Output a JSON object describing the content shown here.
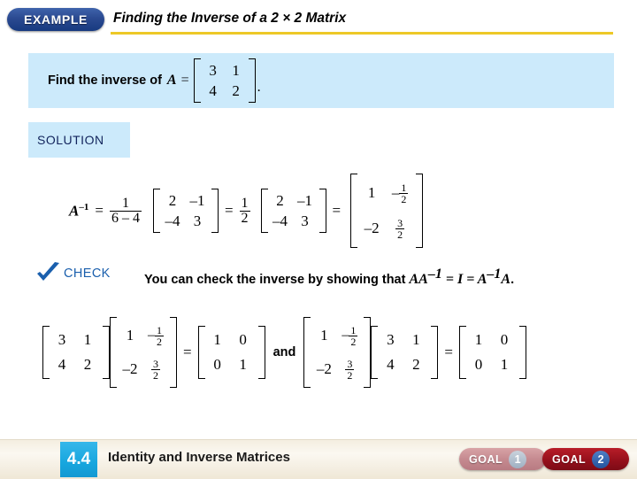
{
  "header": {
    "badge_label": "EXAMPLE",
    "title": "Finding the Inverse of a 2 × 2 Matrix",
    "rule_color": "#edc827",
    "badge_color": "#2b4a91"
  },
  "problem": {
    "text_before": "Find the inverse of",
    "var": "A",
    "equals": "=",
    "matrix": [
      [
        "3",
        "1"
      ],
      [
        "4",
        "2"
      ]
    ],
    "period": ".",
    "box_color": "#cceafb"
  },
  "solution": {
    "label": "SOLUTION",
    "box_color": "#cceafb",
    "label_color": "#12245c",
    "lhs_var": "A",
    "lhs_exp": "–1",
    "eq1": "=",
    "scalar1_num": "1",
    "scalar1_den": "6 – 4",
    "matrix1": [
      [
        "2",
        "–1"
      ],
      [
        "–4",
        "3"
      ]
    ],
    "eq2": "=",
    "scalar2_num": "1",
    "scalar2_den": "2",
    "matrix2": [
      [
        "2",
        "–1"
      ],
      [
        "–4",
        "3"
      ]
    ],
    "eq3": "=",
    "result": {
      "r0c0": "1",
      "r0c1_sign": "–",
      "r0c1_num": "1",
      "r0c1_den": "2",
      "r1c0": "–2",
      "r1c1_num": "3",
      "r1c1_den": "2"
    }
  },
  "check": {
    "label": "CHECK",
    "label_color": "#1a5fad",
    "icon": "checkmark-icon",
    "sentence_part1": "You can check the inverse by showing that ",
    "expr_a1": "AA",
    "expr_exp1": "–1",
    "expr_mid": " = ",
    "expr_i": "I",
    "expr_eq2": " = ",
    "expr_a2": "A",
    "expr_exp2": "–1",
    "expr_a3": "A",
    "sentence_end": "."
  },
  "verification": {
    "left_matrix": [
      [
        "3",
        "1"
      ],
      [
        "4",
        "2"
      ]
    ],
    "inverse": {
      "r0c0": "1",
      "r0c1_sign": "–",
      "r0c1_num": "1",
      "r0c1_den": "2",
      "r1c0": "–2",
      "r1c1_num": "3",
      "r1c1_den": "2"
    },
    "eq": "=",
    "identity": [
      [
        "1",
        "0"
      ],
      [
        "0",
        "1"
      ]
    ],
    "conjunction": "and"
  },
  "footer": {
    "section_number": "4.4",
    "section_title": "Identity and Inverse Matrices",
    "section_box_color": "#17a6de",
    "band_color": "#f4eee0",
    "goals": [
      {
        "label": "GOAL",
        "number": "1",
        "color": "#c58a90"
      },
      {
        "label": "GOAL",
        "number": "2",
        "color": "#96101c"
      }
    ]
  }
}
